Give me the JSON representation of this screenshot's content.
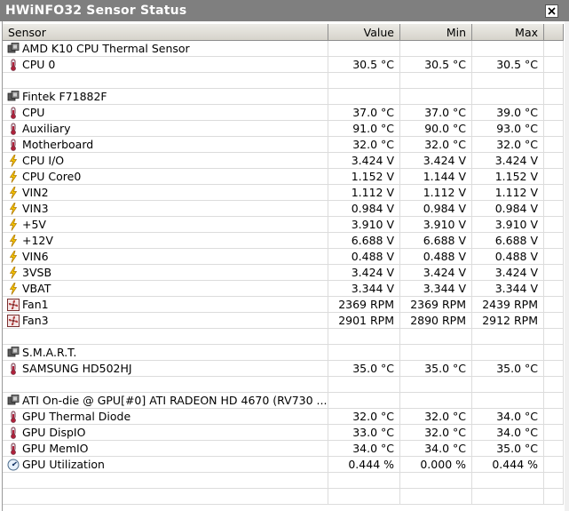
{
  "window": {
    "title": "HWiNFO32 Sensor Status"
  },
  "columns": {
    "sensor": "Sensor",
    "value": "Value",
    "min": "Min",
    "max": "Max"
  },
  "rows": [
    {
      "type": "group",
      "icon": "chip-icon",
      "sensor": "AMD K10 CPU Thermal Sensor",
      "value": "",
      "min": "",
      "max": ""
    },
    {
      "type": "item",
      "icon": "thermometer-icon",
      "sensor": "CPU 0",
      "value": "30.5 °C",
      "min": "30.5 °C",
      "max": "30.5 °C"
    },
    {
      "type": "blank",
      "icon": "",
      "sensor": "",
      "value": "",
      "min": "",
      "max": ""
    },
    {
      "type": "group",
      "icon": "chip-icon",
      "sensor": "Fintek F71882F",
      "value": "",
      "min": "",
      "max": ""
    },
    {
      "type": "item",
      "icon": "thermometer-icon",
      "sensor": "CPU",
      "value": "37.0 °C",
      "min": "37.0 °C",
      "max": "39.0 °C"
    },
    {
      "type": "item",
      "icon": "thermometer-icon",
      "sensor": "Auxiliary",
      "value": "91.0 °C",
      "min": "90.0 °C",
      "max": "93.0 °C"
    },
    {
      "type": "item",
      "icon": "thermometer-icon",
      "sensor": "Motherboard",
      "value": "32.0 °C",
      "min": "32.0 °C",
      "max": "32.0 °C"
    },
    {
      "type": "item",
      "icon": "lightning-icon",
      "sensor": "CPU I/O",
      "value": "3.424 V",
      "min": "3.424 V",
      "max": "3.424 V"
    },
    {
      "type": "item",
      "icon": "lightning-icon",
      "sensor": "CPU Core0",
      "value": "1.152 V",
      "min": "1.144 V",
      "max": "1.152 V"
    },
    {
      "type": "item",
      "icon": "lightning-icon",
      "sensor": "VIN2",
      "value": "1.112 V",
      "min": "1.112 V",
      "max": "1.112 V"
    },
    {
      "type": "item",
      "icon": "lightning-icon",
      "sensor": "VIN3",
      "value": "0.984 V",
      "min": "0.984 V",
      "max": "0.984 V"
    },
    {
      "type": "item",
      "icon": "lightning-icon",
      "sensor": "+5V",
      "value": "3.910 V",
      "min": "3.910 V",
      "max": "3.910 V"
    },
    {
      "type": "item",
      "icon": "lightning-icon",
      "sensor": "+12V",
      "value": "6.688 V",
      "min": "6.688 V",
      "max": "6.688 V"
    },
    {
      "type": "item",
      "icon": "lightning-icon",
      "sensor": "VIN6",
      "value": "0.488 V",
      "min": "0.488 V",
      "max": "0.488 V"
    },
    {
      "type": "item",
      "icon": "lightning-icon",
      "sensor": "3VSB",
      "value": "3.424 V",
      "min": "3.424 V",
      "max": "3.424 V"
    },
    {
      "type": "item",
      "icon": "lightning-icon",
      "sensor": "VBAT",
      "value": "3.344 V",
      "min": "3.344 V",
      "max": "3.344 V"
    },
    {
      "type": "item",
      "icon": "fan-icon",
      "sensor": "Fan1",
      "value": "2369 RPM",
      "min": "2369 RPM",
      "max": "2439 RPM"
    },
    {
      "type": "item",
      "icon": "fan-icon",
      "sensor": "Fan3",
      "value": "2901 RPM",
      "min": "2890 RPM",
      "max": "2912 RPM"
    },
    {
      "type": "blank",
      "icon": "",
      "sensor": "",
      "value": "",
      "min": "",
      "max": ""
    },
    {
      "type": "group",
      "icon": "chip-icon",
      "sensor": "S.M.A.R.T.",
      "value": "",
      "min": "",
      "max": ""
    },
    {
      "type": "item",
      "icon": "thermometer-icon",
      "sensor": "SAMSUNG HD502HJ",
      "value": "35.0 °C",
      "min": "35.0 °C",
      "max": "35.0 °C"
    },
    {
      "type": "blank",
      "icon": "",
      "sensor": "",
      "value": "",
      "min": "",
      "max": ""
    },
    {
      "type": "group",
      "icon": "chip-icon",
      "sensor": "ATI On-die @ GPU[#0] ATI RADEON HD 4670 (RV730 ...",
      "value": "",
      "min": "",
      "max": ""
    },
    {
      "type": "item",
      "icon": "thermometer-icon",
      "sensor": "GPU Thermal Diode",
      "value": "32.0 °C",
      "min": "32.0 °C",
      "max": "34.0 °C"
    },
    {
      "type": "item",
      "icon": "thermometer-icon",
      "sensor": "GPU DispIO",
      "value": "33.0 °C",
      "min": "32.0 °C",
      "max": "34.0 °C"
    },
    {
      "type": "item",
      "icon": "thermometer-icon",
      "sensor": "GPU MemIO",
      "value": "34.0 °C",
      "min": "34.0 °C",
      "max": "35.0 °C"
    },
    {
      "type": "item",
      "icon": "gauge-icon",
      "sensor": "GPU Utilization",
      "value": "0.444 %",
      "min": "0.000 %",
      "max": "0.444 %"
    },
    {
      "type": "blank",
      "icon": "",
      "sensor": "",
      "value": "",
      "min": "",
      "max": ""
    },
    {
      "type": "blank",
      "icon": "",
      "sensor": "",
      "value": "",
      "min": "",
      "max": ""
    }
  ]
}
